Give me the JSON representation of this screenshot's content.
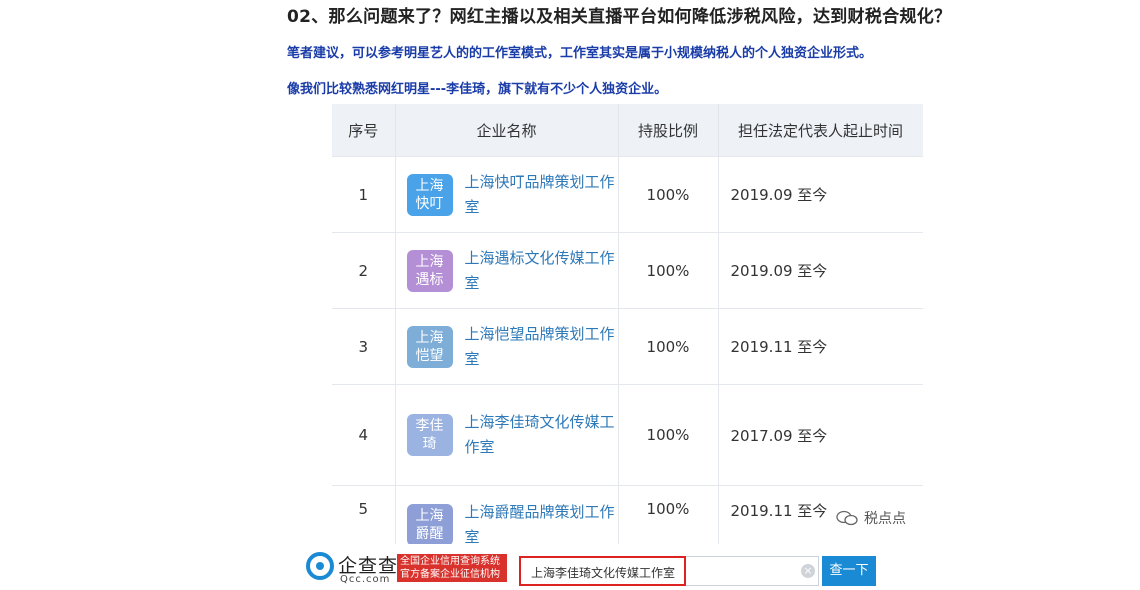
{
  "heading": "02、那么问题来了？网红主播以及相关直播平台如何降低涉税风险，达到财税合规化？",
  "note1": "笔者建议，可以参考明星艺人的的工作室模式，工作室其实是属于小规模纳税人的个人独资企业形式。",
  "note2": "像我们比较熟悉网红明星---李佳琦，旗下就有不少个人独资企业。",
  "table": {
    "headers": [
      "序号",
      "企业名称",
      "持股比例",
      "担任法定代表人起止时间"
    ],
    "rows": [
      {
        "index": "1",
        "logo": "上海快叮",
        "logo_color": "#4aa3e8",
        "name": "上海快叮品牌策划工作室",
        "share": "100%",
        "period": "2019.09 至今"
      },
      {
        "index": "2",
        "logo": "上海遇标",
        "logo_color": "#b58fd6",
        "name": "上海遇标文化传媒工作室",
        "share": "100%",
        "period": "2019.09 至今"
      },
      {
        "index": "3",
        "logo": "上海恺望",
        "logo_color": "#7eaed8",
        "name": "上海恺望品牌策划工作室",
        "share": "100%",
        "period": "2019.11 至今"
      },
      {
        "index": "4",
        "logo": "李佳琦",
        "logo_color": "#9ab3e0",
        "name": "上海李佳琦文化传媒工作室",
        "share": "100%",
        "period": "2017.09 至今"
      },
      {
        "index": "5",
        "logo": "上海爵醒",
        "logo_color": "#8d9fd6",
        "name": "上海爵醒品牌策划工作室",
        "share": "100%",
        "period": "2019.11 至今"
      }
    ]
  },
  "watermark": "税点点",
  "footer": {
    "brand": "企查查",
    "brand_sub": "Qcc.com",
    "badge": "全国企业信用查询系统官方备案企业征信机构",
    "search_value": "上海李佳琦文化传媒工作室",
    "clear": "×",
    "search_button": "查一下"
  }
}
